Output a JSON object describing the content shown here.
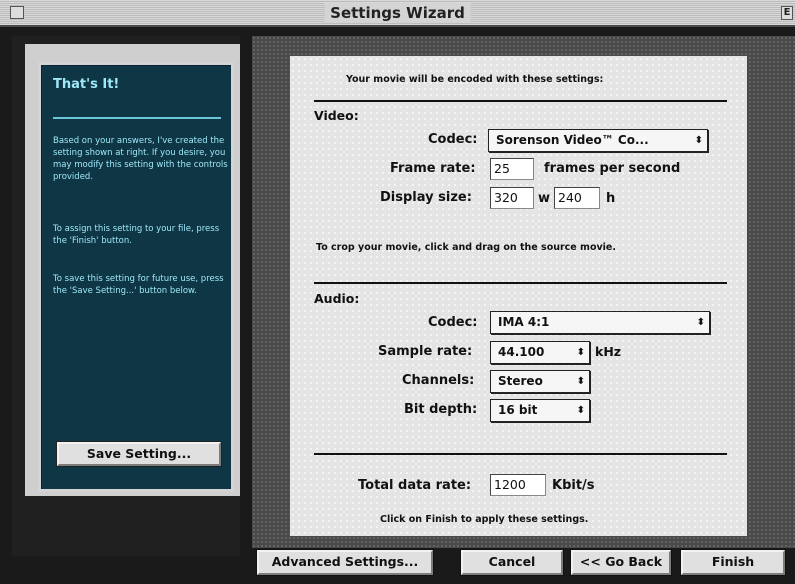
{
  "window": {
    "title": "Settings Wizard",
    "zoom_glyph": "E"
  },
  "sidebar": {
    "heading": "That's It!",
    "paragraphs": [
      "Based on your answers, I've created the setting shown at right.  If you desire, you may modify this setting with the controls provided.",
      "To assign this setting to your file, press the 'Finish' button.",
      "To save this setting for future use, press the 'Save Setting...' button below."
    ],
    "save_button": "Save Setting..."
  },
  "main": {
    "intro": "Your movie will be encoded with these settings:",
    "video": {
      "section_label": "Video:",
      "codec_label": "Codec:",
      "codec_value": "Sorenson Video™ Co...",
      "frame_rate_label": "Frame rate:",
      "frame_rate_value": "25",
      "frame_rate_unit": "frames per second",
      "display_size_label": "Display size:",
      "width_value": "320",
      "width_unit": "w",
      "height_value": "240",
      "height_unit": "h",
      "crop_hint": "To crop your movie, click and drag on the source movie."
    },
    "audio": {
      "section_label": "Audio:",
      "codec_label": "Codec:",
      "codec_value": "IMA 4:1",
      "sample_rate_label": "Sample rate:",
      "sample_rate_value": "44.100",
      "sample_rate_unit": "kHz",
      "channels_label": "Channels:",
      "channels_value": "Stereo",
      "bit_depth_label": "Bit depth:",
      "bit_depth_value": "16 bit"
    },
    "total": {
      "label": "Total data rate:",
      "value": "1200",
      "unit": "Kbit/s"
    },
    "finish_hint": "Click on Finish to apply these settings."
  },
  "footer": {
    "advanced": "Advanced Settings...",
    "cancel": "Cancel",
    "go_back": "<< Go Back",
    "finish": "Finish"
  },
  "icons": {
    "popup_arrow": "popup-arrows-icon"
  },
  "colors": {
    "sidebar_bg": "#0f3645",
    "sidebar_text": "#9ee8f8",
    "panel_bg": "#e4e4e4"
  }
}
